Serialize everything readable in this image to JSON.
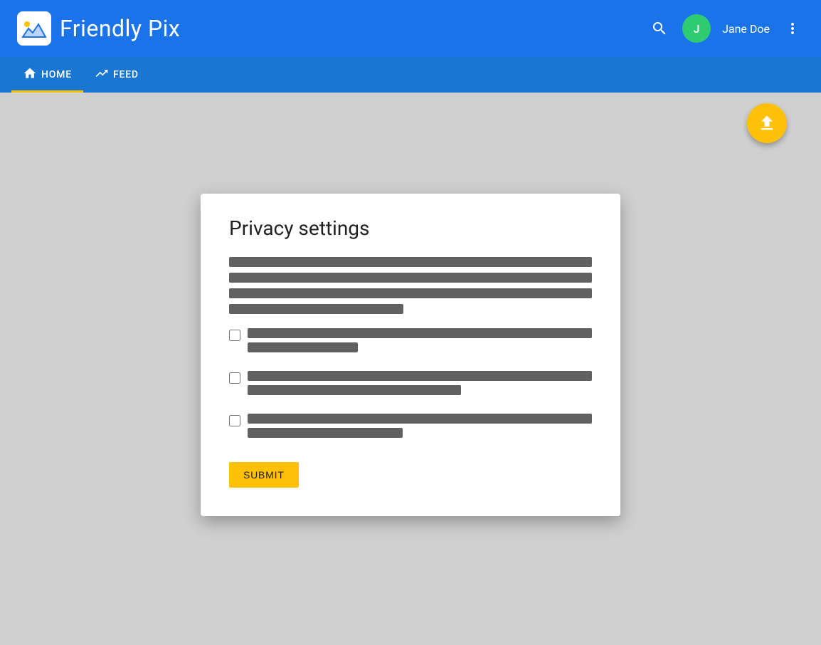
{
  "header": {
    "app_title": "Friendly Pix",
    "username": "Jane Doe",
    "search_label": "Search",
    "more_label": "More options",
    "upload_label": "Upload"
  },
  "navbar": {
    "items": [
      {
        "id": "home",
        "label": "HOME",
        "icon": "home",
        "active": true
      },
      {
        "id": "feed",
        "label": "FEED",
        "icon": "trending_up",
        "active": false
      }
    ]
  },
  "dialog": {
    "title": "Privacy settings",
    "submit_label": "SUBMIT",
    "description_bars": [
      {
        "width": "100%"
      },
      {
        "width": "100%"
      },
      {
        "width": "100%"
      },
      {
        "width": "48%"
      }
    ],
    "checkboxes": [
      {
        "id": "checkbox1",
        "checked": false,
        "bar1_width": "100%",
        "bar2_width": "32%"
      },
      {
        "id": "checkbox2",
        "checked": false,
        "bar1_width": "100%",
        "bar2_width": "62%"
      },
      {
        "id": "checkbox3",
        "checked": false,
        "bar1_width": "100%",
        "bar2_width": "42%"
      }
    ]
  },
  "colors": {
    "header_bg": "#1a73e8",
    "navbar_bg": "#1976d2",
    "fab_bg": "#ffc107",
    "submit_bg": "#ffc107",
    "text_bar_color": "#616161",
    "active_indicator": "#ffc107"
  }
}
